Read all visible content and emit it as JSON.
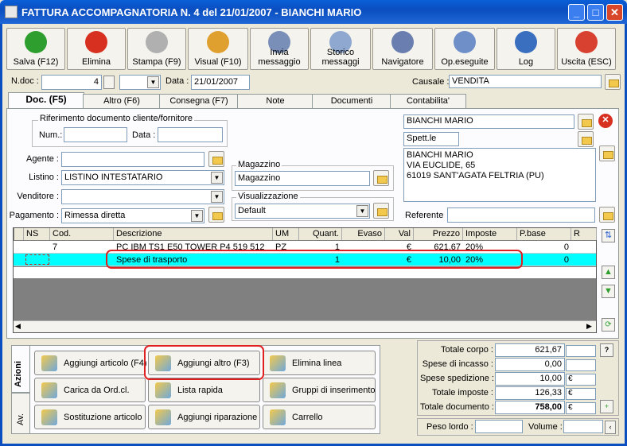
{
  "window": {
    "title": "FATTURA ACCOMPAGNATORIA N. 4  del 21/01/2007 - BIANCHI MARIO",
    "minimize": "_",
    "maximize": "□",
    "close": "✕"
  },
  "toolbar": [
    {
      "label": "Salva (F12)",
      "icon": "check-icon",
      "color": "#2e9e2e"
    },
    {
      "label": "Elimina",
      "icon": "delete-x-icon",
      "color": "#d83020"
    },
    {
      "label": "Stampa (F9)",
      "icon": "printer-icon",
      "color": "#b0b0b0"
    },
    {
      "label": "Visual (F10)",
      "icon": "magic-wand-icon",
      "color": "#e0a030"
    },
    {
      "label": "Invia messaggio",
      "icon": "envelope-icon",
      "color": "#7a8fb8"
    },
    {
      "label": "Storico messaggi",
      "icon": "mail-search-icon",
      "color": "#8fa8d0"
    },
    {
      "label": "Navigatore",
      "icon": "compass-icon",
      "color": "#6a7fb0"
    },
    {
      "label": "Op.eseguite",
      "icon": "gears-icon",
      "color": "#6f8fc8"
    },
    {
      "label": "Log",
      "icon": "magnifier-icon",
      "color": "#3a6fc0"
    },
    {
      "label": "Uscita (ESC)",
      "icon": "exit-icon",
      "color": "#d84030"
    }
  ],
  "header": {
    "ndoc_label": "N.doc :",
    "ndoc_value": "4",
    "data_label": "Data :",
    "data_value": "21/01/2007",
    "causale_label": "Causale :",
    "causale_value": "VENDITA"
  },
  "tabs": [
    "Doc. (F5)",
    "Altro (F6)",
    "Consegna (F7)",
    "Note",
    "Documenti",
    "Contabilita'"
  ],
  "rif": {
    "legend": "Riferimento documento cliente/fornitore",
    "num_label": "Num.:",
    "data_label": "Data :"
  },
  "fields": {
    "agente_label": "Agente :",
    "listino_label": "Listino :",
    "listino_value": "LISTINO INTESTATARIO",
    "venditore_label": "Venditore :",
    "pagamento_label": "Pagamento :",
    "pagamento_value": "Rimessa diretta"
  },
  "magazzino": {
    "legend": "Magazzino",
    "value": "Magazzino"
  },
  "visualizzazione": {
    "legend": "Visualizzazione",
    "value": "Default"
  },
  "customer": {
    "name": "BIANCHI MARIO",
    "salutation": "Spett.le",
    "address_lines": [
      "BIANCHI MARIO",
      "VIA EUCLIDE, 65",
      "61019 SANT'AGATA FELTRIA (PU)"
    ],
    "referente_label": "Referente"
  },
  "grid": {
    "columns": [
      "NS",
      "Cod.",
      "Descrizione",
      "UM",
      "Quant.",
      "Evaso",
      "Val",
      "Prezzo",
      "Imposte",
      "P.base",
      "R"
    ],
    "rows": [
      [
        "",
        "7",
        "PC IBM TS1 E50 TOWER P4 519 512",
        "PZ",
        "1",
        "",
        "€",
        "621,67",
        "20%",
        "0",
        ""
      ],
      [
        "",
        "",
        "Spese di trasporto",
        "",
        "1",
        "",
        "€",
        "10,00",
        "20%",
        "0",
        ""
      ]
    ]
  },
  "side_tabs": [
    "Azioni",
    "Av."
  ],
  "actions": [
    {
      "label": "Aggiungi articolo (F4)",
      "icon": "add-article-icon"
    },
    {
      "label": "Aggiungi altro (F3)",
      "icon": "add-other-icon"
    },
    {
      "label": "Elimina linea",
      "icon": "delete-line-icon"
    },
    {
      "label": "Carica da Ord.cl.",
      "icon": "load-order-icon"
    },
    {
      "label": "Lista rapida",
      "icon": "quick-list-icon"
    },
    {
      "label": "Gruppi di inserimento",
      "icon": "star-group-icon"
    },
    {
      "label": "Sostituzione articolo",
      "icon": "replace-article-icon"
    },
    {
      "label": "Aggiungi riparazione",
      "icon": "repair-gear-icon"
    },
    {
      "label": "Carrello",
      "icon": "cart-icon"
    }
  ],
  "totals": [
    {
      "label": "Totale corpo :",
      "value": "621,67",
      "suffix": ""
    },
    {
      "label": "Spese di incasso :",
      "value": "0,00",
      "suffix": ""
    },
    {
      "label": "Spese spedizione :",
      "value": "10,00",
      "suffix": "€"
    },
    {
      "label": "Totale imposte :",
      "value": "126,33",
      "suffix": "€"
    },
    {
      "label": "Totale documento :",
      "value": "758,00",
      "suffix": "€"
    }
  ],
  "totals_help": "?",
  "weights": {
    "peso_label": "Peso lordo :",
    "volume_label": "Volume :"
  },
  "colors": {
    "title_bar": "#0a4ec0",
    "selected_row": "#00ffff",
    "highlight_box": "#e02020"
  }
}
